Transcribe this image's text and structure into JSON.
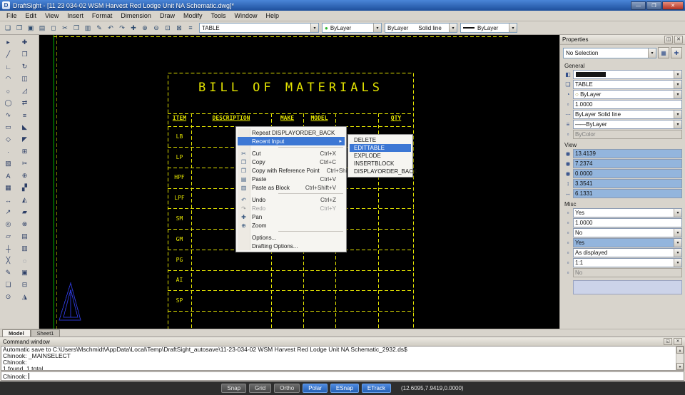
{
  "titlebar": {
    "app_icon": "D",
    "title": "DraftSight  - [11 23 034-02 WSM Harvest Red Lodge Unit NA Schematic.dwg]*",
    "minimize": "—",
    "maximize": "❐",
    "close": "✕"
  },
  "menubar": {
    "items": [
      {
        "name": "menu-file",
        "label": "File"
      },
      {
        "name": "menu-edit",
        "label": "Edit"
      },
      {
        "name": "menu-view",
        "label": "View"
      },
      {
        "name": "menu-insert",
        "label": "Insert"
      },
      {
        "name": "menu-format",
        "label": "Format"
      },
      {
        "name": "menu-dimension",
        "label": "Dimension"
      },
      {
        "name": "menu-draw",
        "label": "Draw"
      },
      {
        "name": "menu-modify",
        "label": "Modify"
      },
      {
        "name": "menu-tools",
        "label": "Tools"
      },
      {
        "name": "menu-window",
        "label": "Window"
      },
      {
        "name": "menu-help",
        "label": "Help"
      }
    ]
  },
  "toolbar": {
    "icons": [
      {
        "name": "new-icon",
        "glyph": "❑"
      },
      {
        "name": "open-icon",
        "glyph": "❒"
      },
      {
        "name": "save-icon",
        "glyph": "▣"
      },
      {
        "name": "print-icon",
        "glyph": "▤"
      },
      {
        "name": "print-preview-icon",
        "glyph": "◻"
      },
      {
        "name": "cut-icon",
        "glyph": "✂"
      },
      {
        "name": "copy-icon",
        "glyph": "❐"
      },
      {
        "name": "paste-icon",
        "glyph": "▥"
      },
      {
        "name": "properties-painter-icon",
        "glyph": "✎"
      },
      {
        "name": "undo-icon",
        "glyph": "↶"
      },
      {
        "name": "redo-icon",
        "glyph": "↷"
      },
      {
        "name": "pan-icon",
        "glyph": "✚"
      },
      {
        "name": "zoom-in-icon",
        "glyph": "⊕"
      },
      {
        "name": "zoom-out-icon",
        "glyph": "⊖"
      },
      {
        "name": "zoom-window-icon",
        "glyph": "⊡"
      },
      {
        "name": "zoom-fit-icon",
        "glyph": "⊠"
      },
      {
        "name": "layer-manager-icon",
        "glyph": "≡"
      }
    ],
    "layer_combo": {
      "value": "TABLE"
    },
    "color_combo": {
      "dot": "●",
      "value": "ByLayer"
    },
    "linestyle_combo": {
      "value": "ByLayer",
      "style_name": "Solid line"
    },
    "lineweight_combo": {
      "value": "ByLayer"
    }
  },
  "tool_palette": {
    "draw_tools": [
      {
        "name": "select-tool-icon",
        "glyph": "▸"
      },
      {
        "name": "line-tool-icon",
        "glyph": "╱"
      },
      {
        "name": "polyline-tool-icon",
        "glyph": "∟"
      },
      {
        "name": "arc-tool-icon",
        "glyph": "◠"
      },
      {
        "name": "circle-tool-icon",
        "glyph": "○"
      },
      {
        "name": "ellipse-tool-icon",
        "glyph": "◯"
      },
      {
        "name": "spline-tool-icon",
        "glyph": "∿"
      },
      {
        "name": "rectangle-tool-icon",
        "glyph": "▭"
      },
      {
        "name": "polygon-tool-icon",
        "glyph": "◇"
      },
      {
        "name": "point-tool-icon",
        "glyph": "·"
      },
      {
        "name": "hatch-tool-icon",
        "glyph": "▨"
      },
      {
        "name": "text-tool-icon",
        "glyph": "A"
      },
      {
        "name": "table-tool-icon",
        "glyph": "▦"
      },
      {
        "name": "dimension-tool-icon",
        "glyph": "↔"
      },
      {
        "name": "leader-tool-icon",
        "glyph": "↗"
      },
      {
        "name": "ring-tool-icon",
        "glyph": "◎"
      },
      {
        "name": "region-tool-icon",
        "glyph": "▱"
      },
      {
        "name": "centerline-tool-icon",
        "glyph": "┼"
      },
      {
        "name": "construction-line-tool-icon",
        "glyph": "╳"
      },
      {
        "name": "sketch-tool-icon",
        "glyph": "✎"
      },
      {
        "name": "block-tool-icon",
        "glyph": "❏"
      },
      {
        "name": "donut-tool-icon",
        "glyph": "⊙"
      }
    ],
    "modify_tools": [
      {
        "name": "move-tool-icon",
        "glyph": "✚"
      },
      {
        "name": "copy-tool-icon",
        "glyph": "❐"
      },
      {
        "name": "rotate-tool-icon",
        "glyph": "↻"
      },
      {
        "name": "mirror-tool-icon",
        "glyph": "◫"
      },
      {
        "name": "scale-tool-icon",
        "glyph": "◿"
      },
      {
        "name": "offset-tool-icon",
        "glyph": "⇄"
      },
      {
        "name": "stretch-tool-icon",
        "glyph": "≡"
      },
      {
        "name": "chamfer-tool-icon",
        "glyph": "◣"
      },
      {
        "name": "fillet-tool-icon",
        "glyph": "◤"
      },
      {
        "name": "array-tool-icon",
        "glyph": "⊞"
      },
      {
        "name": "trim-tool-icon",
        "glyph": "✂"
      },
      {
        "name": "extend-tool-icon",
        "glyph": "⊕"
      },
      {
        "name": "split-tool-icon",
        "glyph": "▞"
      },
      {
        "name": "explode-tool-icon",
        "glyph": "◭"
      },
      {
        "name": "edit-polyline-tool-icon",
        "glyph": "▰"
      },
      {
        "name": "delete-tool-icon",
        "glyph": "⊗"
      },
      {
        "name": "properties-tool-icon",
        "glyph": "▤"
      },
      {
        "name": "layers-tool-icon",
        "glyph": "▥"
      },
      {
        "name": "point-style-tool-icon",
        "glyph": "◌"
      },
      {
        "name": "block-edit-tool-icon",
        "glyph": "▣"
      },
      {
        "name": "subtract-tool-icon",
        "glyph": "⊟"
      },
      {
        "name": "weld-tool-icon",
        "glyph": "◮"
      }
    ]
  },
  "canvas": {
    "bom": {
      "title": "BILL OF MATERIALS",
      "headers": [
        {
          "label": "ITEM"
        },
        {
          "label": "DESCRIPTION"
        },
        {
          "label": "MAKE"
        },
        {
          "label": "MODEL"
        },
        {
          "label": "QTY"
        }
      ],
      "items": [
        {
          "label": "LB"
        },
        {
          "label": "LP"
        },
        {
          "label": "HPF"
        },
        {
          "label": "LPF"
        },
        {
          "label": "SM"
        },
        {
          "label": "GM"
        },
        {
          "label": "PG"
        },
        {
          "label": "AI"
        },
        {
          "label": "SP"
        }
      ]
    }
  },
  "context_menu": {
    "items": [
      {
        "name": "menu-item-repeat",
        "label": "Repeat DISPLAYORDER_BACK"
      },
      {
        "name": "menu-item-recent-input",
        "label": "Recent Input",
        "arrow": "▸",
        "cls": "sel"
      },
      {
        "name": "menu-separator",
        "cls": "sep"
      },
      {
        "name": "menu-item-cut",
        "icon": "✂",
        "label": "Cut",
        "shortcut": "Ctrl+X"
      },
      {
        "name": "menu-item-copy",
        "icon": "❐",
        "label": "Copy",
        "shortcut": "Ctrl+C"
      },
      {
        "name": "menu-item-copy-with-reference",
        "icon": "❒",
        "label": "Copy with Reference Point",
        "shortcut": "Ctrl+Shift+C"
      },
      {
        "name": "menu-item-paste",
        "icon": "▤",
        "label": "Paste",
        "shortcut": "Ctrl+V"
      },
      {
        "name": "menu-item-paste-as-block",
        "icon": "▥",
        "label": "Paste as Block",
        "shortcut": "Ctrl+Shift+V"
      },
      {
        "name": "menu-separator",
        "cls": "sep"
      },
      {
        "name": "menu-item-undo",
        "icon": "↶",
        "label": "Undo",
        "shortcut": "Ctrl+Z"
      },
      {
        "name": "menu-item-redo",
        "icon": "↷",
        "label": "Redo",
        "shortcut": "Ctrl+Y",
        "cls": "disabled"
      },
      {
        "name": "menu-item-pan",
        "icon": "✚",
        "label": "Pan"
      },
      {
        "name": "menu-item-zoom",
        "icon": "⊕",
        "label": "Zoom"
      },
      {
        "name": "menu-separator",
        "cls": "sep"
      },
      {
        "name": "menu-item-options",
        "label": "Options..."
      },
      {
        "name": "menu-item-drafting-options",
        "label": "Drafting Options..."
      }
    ]
  },
  "submenu": {
    "items": [
      {
        "name": "submenu-item-delete",
        "label": "DELETE"
      },
      {
        "name": "submenu-item-edittable",
        "label": "EDITTABLE",
        "cls": "sel"
      },
      {
        "name": "submenu-item-explode",
        "label": "EXPLODE"
      },
      {
        "name": "submenu-item-insertblock",
        "label": "INSERTBLOCK"
      },
      {
        "name": "submenu-item-displayorder-back",
        "label": "DISPLAYORDER_BACK"
      }
    ]
  },
  "properties": {
    "title": "Properties",
    "pin_icon": "◫",
    "close_icon": "✕",
    "selection": "No Selection",
    "buttons": [
      {
        "name": "select-entities-button",
        "glyph": "▦"
      },
      {
        "name": "selection-options-button",
        "glyph": "✚"
      }
    ],
    "sections": [
      {
        "label": "General",
        "rows": [
          {
            "name": "color-property-row",
            "icon": "◧",
            "value": "",
            "cls": "swatch"
          },
          {
            "name": "layer-property-row",
            "icon": "❏",
            "value": "TABLE"
          },
          {
            "name": "linecolor-property-row",
            "icon": "◔",
            "value": "ByLayer",
            "cls": "circ"
          },
          {
            "name": "linescale-property-row",
            "icon": "▫",
            "value": "1.0000",
            "cls": "noarrow"
          },
          {
            "name": "linestyle-property-row",
            "icon": "⋯",
            "value": "ByLayer    Solid line"
          },
          {
            "name": "lineweight-property-row",
            "icon": "≡",
            "value": "ByLayer",
            "cls": "lwt"
          },
          {
            "name": "plotstyle-property-row",
            "icon": "▫",
            "value": "ByColor",
            "cls": "dis noarrow"
          }
        ]
      },
      {
        "label": "View",
        "rows": [
          {
            "name": "center-x-property-row",
            "icon": "◉",
            "value": "13.4139",
            "cls": "hl noarrow"
          },
          {
            "name": "center-y-property-row",
            "icon": "◉",
            "value": "7.2374",
            "cls": "hl noarrow"
          },
          {
            "name": "center-z-property-row",
            "icon": "◉",
            "value": "0.0000",
            "cls": "hl noarrow"
          },
          {
            "name": "view-height-property-row",
            "icon": "↕",
            "value": "3.3541",
            "cls": "hl noarrow"
          },
          {
            "name": "view-width-property-row",
            "icon": "↔",
            "value": "6.1331",
            "cls": "hl noarrow"
          }
        ]
      },
      {
        "label": "Misc",
        "rows": [
          {
            "name": "misc-property-row",
            "icon": "▫",
            "value": "Yes"
          },
          {
            "name": "misc-property-row",
            "icon": "▫",
            "value": "1.0000",
            "cls": "noarrow"
          },
          {
            "name": "misc-property-row",
            "icon": "▫",
            "value": "No"
          },
          {
            "name": "misc-property-row",
            "icon": "▫",
            "value": "Yes",
            "cls": "hl"
          },
          {
            "name": "misc-property-row",
            "icon": "▫",
            "value": "As displayed"
          },
          {
            "name": "misc-property-row",
            "icon": "▫",
            "value": "1:1"
          },
          {
            "name": "misc-property-row",
            "icon": "▫",
            "value": "No",
            "cls": "dis noarrow"
          }
        ]
      }
    ]
  },
  "tabs": {
    "model": "Model",
    "sheet1": "Sheet1"
  },
  "command": {
    "title": "Command window",
    "float_icon": "◱",
    "close_icon": "✕",
    "scroll_up": "▲",
    "scroll_down": "▼",
    "lines": [
      "Automatic save to C:\\Users\\Mschmidt\\AppData\\Local\\Temp\\DraftSight_autosave\\11-23-034-02 WSM Harvest Red Lodge Unit NA Schematic_2932.ds$",
      "Chinook: _MAINSELECT",
      "Chinook:",
      "1 found, 1 total"
    ],
    "prompt": "Chinook:"
  },
  "statusbar": {
    "buttons": [
      {
        "name": "snap-toggle",
        "label": "Snap"
      },
      {
        "name": "grid-toggle",
        "label": "Grid"
      },
      {
        "name": "ortho-toggle",
        "label": "Ortho"
      },
      {
        "name": "polar-toggle",
        "label": "Polar",
        "cls": "active"
      },
      {
        "name": "esnap-toggle",
        "label": "ESnap",
        "cls": "active"
      },
      {
        "name": "etrack-toggle",
        "label": "ETrack",
        "cls": "active"
      }
    ],
    "coords": "(12.6095,7.9419,0.0000)"
  },
  "colors": {
    "cad_yellow": "#e3e300",
    "sheet_green": "#00b400",
    "triangle_blue": "#2a35c8",
    "menu_highlight": "#3c77d4",
    "field_highlight": "#93b5dd",
    "color_dot_green": "#2db52d"
  }
}
